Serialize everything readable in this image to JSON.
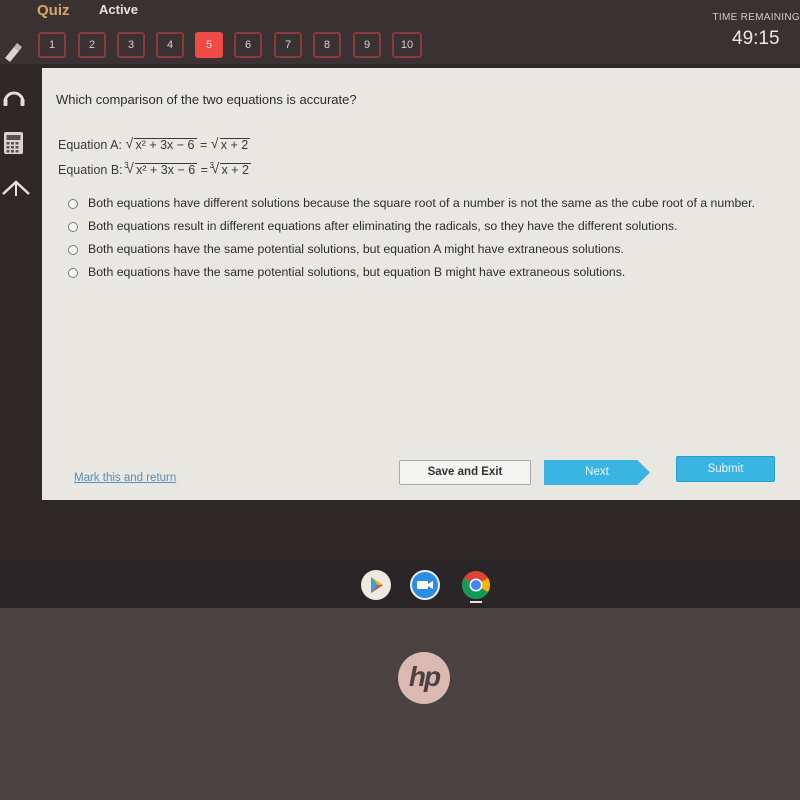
{
  "header": {
    "app_title": "Quiz",
    "status": "Active",
    "questions": [
      "1",
      "2",
      "3",
      "4",
      "5",
      "6",
      "7",
      "8",
      "9",
      "10"
    ],
    "current_question": "5",
    "time_label": "TIME REMAINING",
    "time_remaining": "49:15"
  },
  "tools": [
    "pencil-icon",
    "headphones-icon",
    "calculator-icon",
    "collapse-up-icon"
  ],
  "question": {
    "prompt": "Which comparison of the two equations is accurate?",
    "equation_a_label": "Equation A:",
    "equation_a_left": "x² + 3x − 6",
    "equation_a_right": "x + 2",
    "equation_b_label": "Equation B:",
    "equation_b_index": "3",
    "equation_b_left": "x² + 3x − 6",
    "equation_b_right": "x + 2",
    "options": [
      "Both equations have different solutions because the square root of a number is not the same as the cube root of a number.",
      "Both equations result in different equations after eliminating the radicals, so they have the different solutions.",
      "Both equations have the same potential solutions, but equation A might have extraneous solutions.",
      "Both equations have the same potential solutions, but equation B might have extraneous solutions."
    ]
  },
  "footer": {
    "mark_link": "Mark this and return",
    "save_label": "Save and Exit",
    "next_label": "Next",
    "submit_label": "Submit"
  },
  "shelf": [
    "play-store-icon",
    "zoom-icon",
    "chrome-icon"
  ],
  "device": {
    "logo": "hp"
  },
  "colors": {
    "accent_red": "#ef4a43",
    "accent_blue": "#3ab4e3",
    "quiz_gold": "#d7a86a"
  }
}
